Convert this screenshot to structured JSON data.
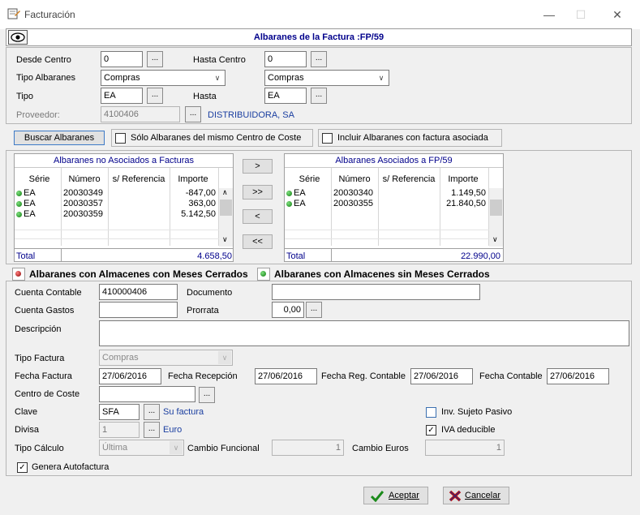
{
  "window": {
    "title": "Facturación",
    "minimize": "—",
    "maximize": "☐",
    "close": "✕"
  },
  "header": {
    "title": "Albaranes de la Factura :FP/59"
  },
  "filters": {
    "desde_centro_label": "Desde Centro",
    "desde_centro": "0",
    "hasta_centro_label": "Hasta Centro",
    "hasta_centro": "0",
    "tipo_albaranes_label": "Tipo Albaranes",
    "tipo_albaranes_desde": "Compras",
    "tipo_albaranes_hasta": "Compras",
    "tipo_label": "Tipo",
    "tipo_desde": "EA",
    "hasta_label": "Hasta",
    "tipo_hasta": "EA",
    "proveedor_label": "Proveedor:",
    "proveedor": "4100406",
    "proveedor_name": "DISTRIBUIDORA, SA",
    "ellipsis": "..."
  },
  "search": {
    "button": "Buscar Albaranes",
    "same_cost_center": "Sólo Albaranes del mismo Centro de Coste",
    "include_invoiced": "Incluir Albaranes con factura asociada"
  },
  "left_list": {
    "title": "Albaranes no Asociados a Facturas",
    "headers": [
      "Série",
      "Número",
      "s/ Referencia",
      "Importe"
    ],
    "rows": [
      {
        "serie": "EA",
        "numero": "20030349",
        "ref": "",
        "importe": "-847,00"
      },
      {
        "serie": "EA",
        "numero": "20030357",
        "ref": "",
        "importe": "363,00"
      },
      {
        "serie": "EA",
        "numero": "20030359",
        "ref": "",
        "importe": "5.142,50"
      }
    ],
    "total_label": "Total",
    "total": "4.658,50"
  },
  "right_list": {
    "title": "Albaranes Asociados a FP/59",
    "headers": [
      "Série",
      "Número",
      "s/ Referencia",
      "Importe"
    ],
    "rows": [
      {
        "serie": "EA",
        "numero": "20030340",
        "ref": "",
        "importe": "1.149,50"
      },
      {
        "serie": "EA",
        "numero": "20030355",
        "ref": "",
        "importe": "21.840,50"
      }
    ],
    "total_label": "Total",
    "total": "22.990,00"
  },
  "transfer": {
    "one_right": ">",
    "all_right": ">>",
    "one_left": "<",
    "all_left": "<<"
  },
  "tabs": {
    "closed": "Albaranes con Almacenes con Meses Cerrados",
    "open": "Albaranes con Almacenes sin Meses Cerrados"
  },
  "form": {
    "cuenta_contable_label": "Cuenta Contable",
    "cuenta_contable": "410000406",
    "documento_label": "Documento",
    "documento": "",
    "cuenta_gastos_label": "Cuenta Gastos",
    "cuenta_gastos": "",
    "prorrata_label": "Prorrata",
    "prorrata": "0,00",
    "descripcion_label": "Descripción",
    "descripcion": "",
    "tipo_factura_label": "Tipo Factura",
    "tipo_factura": "Compras",
    "fecha_factura_label": "Fecha Factura",
    "fecha_factura": "27/06/2016",
    "fecha_recepcion_label": "Fecha Recepción",
    "fecha_recepcion": "27/06/2016",
    "fecha_reg_label": "Fecha Reg. Contable",
    "fecha_reg": "27/06/2016",
    "fecha_contable_label": "Fecha Contable",
    "fecha_contable": "27/06/2016",
    "centro_coste_label": "Centro de Coste",
    "centro_coste": "",
    "clave_label": "Clave",
    "clave": "SFA",
    "clave_desc": "Su factura",
    "divisa_label": "Divisa",
    "divisa": "1",
    "divisa_desc": "Euro",
    "tipo_calculo_label": "Tipo Cálculo",
    "tipo_calculo": "Última",
    "cambio_funcional_label": "Cambio Funcional",
    "cambio_funcional": "1",
    "cambio_euros_label": "Cambio Euros",
    "cambio_euros": "1",
    "inv_sujeto_label": "Inv. Sujeto Pasivo",
    "iva_deducible_label": "IVA deducible",
    "genera_autofactura_label": "Genera Autofactura"
  },
  "footer": {
    "accept": "Aceptar",
    "cancel": "Cancelar"
  }
}
